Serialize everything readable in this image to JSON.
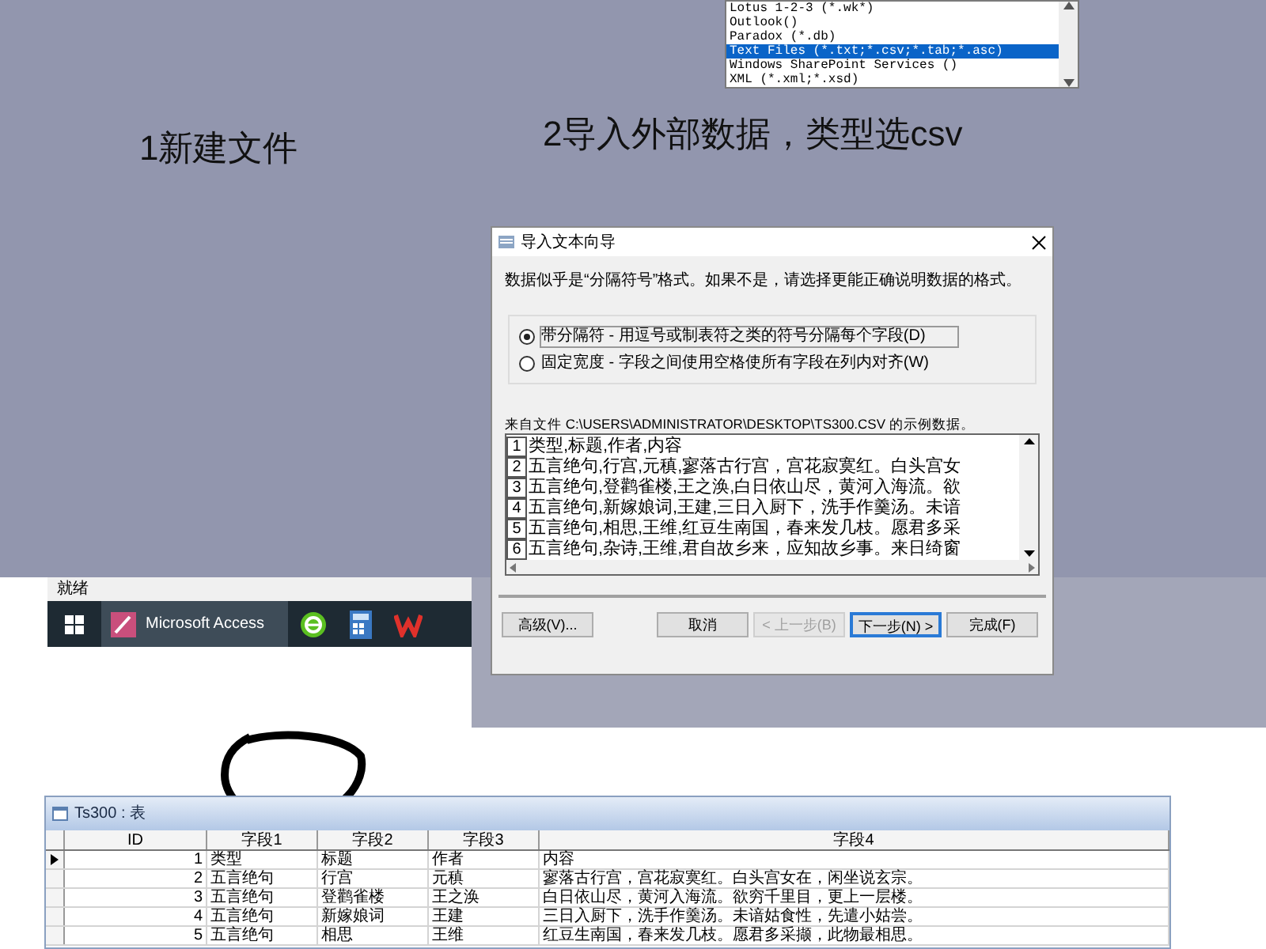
{
  "file_type_list": {
    "items": [
      {
        "label": "Lotus 1-2-3 (*.wk*)",
        "selected": false
      },
      {
        "label": "Outlook()",
        "selected": false
      },
      {
        "label": "Paradox (*.db)",
        "selected": false
      },
      {
        "label": "Text Files (*.txt;*.csv;*.tab;*.asc)",
        "selected": true
      },
      {
        "label": "Windows SharePoint Services ()",
        "selected": false
      },
      {
        "label": "XML (*.xml;*.xsd)",
        "selected": false
      }
    ]
  },
  "annotations": [
    {
      "text": "1新建文件"
    },
    {
      "text": "2导入外部数据，类型选csv"
    }
  ],
  "status_bar": {
    "text": "就绪"
  },
  "taskbar": {
    "apps": [
      {
        "kind": "access",
        "label": "Microsoft Access",
        "selected": true
      },
      {
        "kind": "browser",
        "selected": false
      },
      {
        "kind": "calculator",
        "selected": false
      },
      {
        "kind": "wps",
        "selected": false
      }
    ]
  },
  "dialog": {
    "title": "导入文本向导",
    "message": "数据似乎是“分隔符号”格式。如果不是，请选择更能正确说明数据的格式。",
    "options": [
      {
        "label": "带分隔符 - 用逗号或制表符之类的符号分隔每个字段(D)",
        "selected": true
      },
      {
        "label": "固定宽度 - 字段之间使用空格使所有字段在列内对齐(W)",
        "selected": false
      }
    ],
    "sample_label": "来自文件 C:\\USERS\\ADMINISTRATOR\\DESKTOP\\TS300.CSV 的示例数据。",
    "sample_rows": [
      {
        "number": "1",
        "text": "类型,标题,作者,内容"
      },
      {
        "number": "2",
        "text": "五言绝句,行宫,元稹,寥落古行宫，宫花寂寞红。白头宫女"
      },
      {
        "number": "3",
        "text": "五言绝句,登鹳雀楼,王之涣,白日依山尽，黄河入海流。欲"
      },
      {
        "number": "4",
        "text": "五言绝句,新嫁娘词,王建,三日入厨下，洗手作羹汤。未谙"
      },
      {
        "number": "5",
        "text": "五言绝句,相思,王维,红豆生南国，春来发几枝。愿君多采"
      },
      {
        "number": "6",
        "text": "五言绝句,杂诗,王维,君自故乡来，应知故乡事。来日绮窗"
      }
    ],
    "buttons": [
      {
        "label": "高级(V)...",
        "disabled": false,
        "default": false
      },
      {
        "label": "取消",
        "disabled": false,
        "default": false
      },
      {
        "label": "< 上一步(B)",
        "disabled": true,
        "default": false
      },
      {
        "label": "下一步(N) >",
        "disabled": false,
        "default": true
      },
      {
        "label": "完成(F)",
        "disabled": false,
        "default": false
      }
    ]
  },
  "table": {
    "title": "Ts300 : 表",
    "columns": [
      "ID",
      "字段1",
      "字段2",
      "字段3",
      "字段4"
    ],
    "rows": [
      {
        "selected": true,
        "cells": [
          "1",
          "类型",
          "标题",
          "作者",
          "内容"
        ]
      },
      {
        "selected": false,
        "cells": [
          "2",
          "五言绝句",
          "行宫",
          "元稹",
          "寥落古行宫，宫花寂寞红。白头宫女在，闲坐说玄宗。"
        ]
      },
      {
        "selected": false,
        "cells": [
          "3",
          "五言绝句",
          "登鹳雀楼",
          "王之涣",
          "白日依山尽，黄河入海流。欲穷千里目，更上一层楼。"
        ]
      },
      {
        "selected": false,
        "cells": [
          "4",
          "五言绝句",
          "新嫁娘词",
          "王建",
          "三日入厨下，洗手作羹汤。未谙姑食性，先遣小姑尝。"
        ]
      },
      {
        "selected": false,
        "cells": [
          "5",
          "五言绝句",
          "相思",
          "王维",
          "红豆生南国，春来发几枝。愿君多采撷，此物最相思。"
        ]
      }
    ]
  }
}
